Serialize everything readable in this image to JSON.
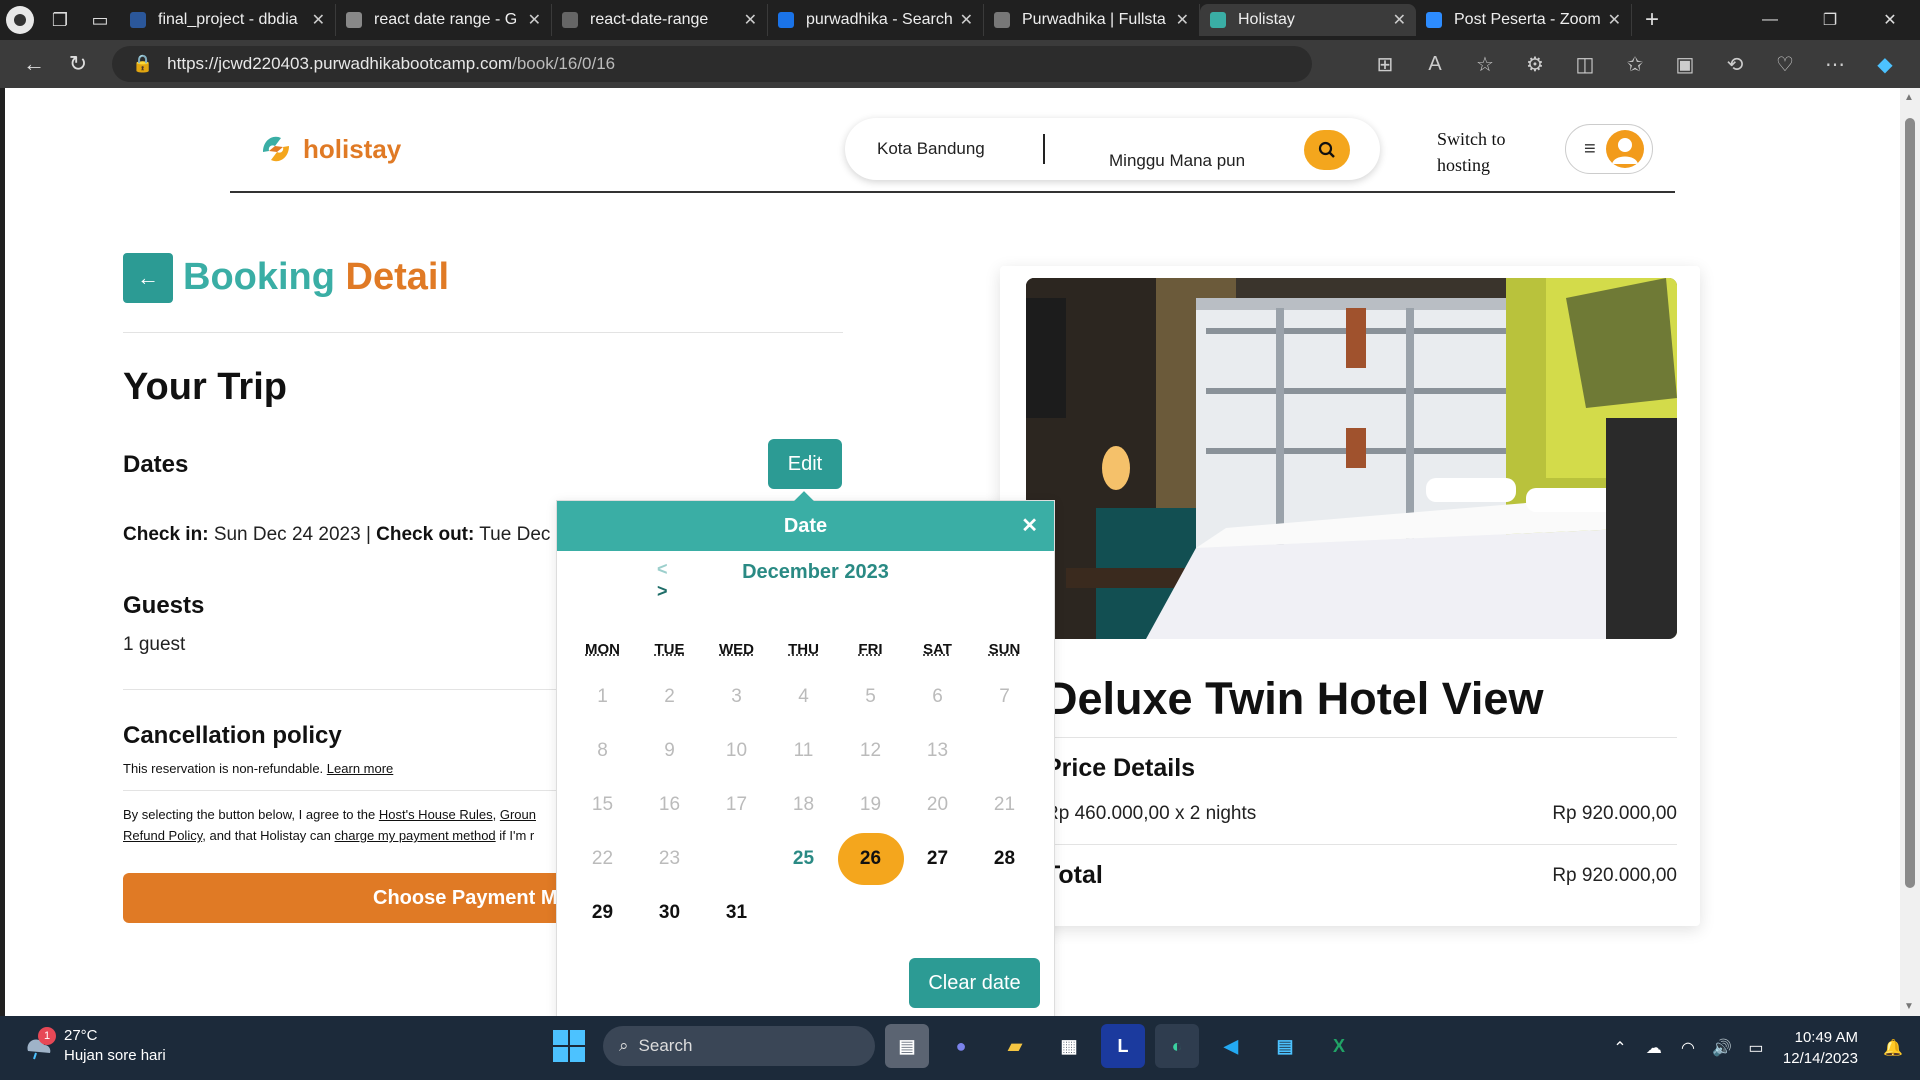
{
  "browser": {
    "tabs": [
      {
        "title": "final_project - dbdia",
        "color": "#2b579a"
      },
      {
        "title": "react date range - G",
        "color": "#888888"
      },
      {
        "title": "react-date-range",
        "color": "#666666"
      },
      {
        "title": "purwadhika - Search",
        "color": "#1a73e8"
      },
      {
        "title": "Purwadhika | Fullsta",
        "color": "#777777"
      },
      {
        "title": "Holistay",
        "color": "#3aaea5",
        "active": true
      },
      {
        "title": "Post Peserta - Zoom",
        "color": "#2d8cff"
      }
    ],
    "url_host": "https://jcwd220403.purwadhikabootcamp.com",
    "url_path": "/book/16/0/16"
  },
  "header": {
    "logo_text": "holistay",
    "search_location": "Kota Bandung",
    "search_week": "Minggu Mana pun",
    "switch_hosting": "Switch to hosting"
  },
  "booking": {
    "title_a": "Booking",
    "title_b": "Detail",
    "your_trip": "Your Trip",
    "dates_heading": "Dates",
    "edit_label": "Edit",
    "check_in_label": "Check in:",
    "check_in_value": "Sun Dec 24 2023",
    "separator": "|",
    "check_out_label": "Check out:",
    "check_out_value": "Tue Dec",
    "guests_heading": "Guests",
    "guests_value": "1 guest",
    "cancel_heading": "Cancellation policy",
    "cancel_text": "This reservation is non-refundable.",
    "learn_more": "Learn more",
    "agree_prefix": "By selecting the button below, I agree to the",
    "agree_link1": "Host's House Rules",
    "agree_link2": "Groun",
    "agree_link3": "Refund Policy",
    "agree_middle": ", and that Holistay can",
    "agree_link4": "charge my payment method",
    "agree_suffix": "if I'm r",
    "pay_button": "Choose Payment Me"
  },
  "summary": {
    "room_title": "Deluxe Twin Hotel View",
    "price_heading": "Price Details",
    "price_line": "Rp 460.000,00 x 2 nights",
    "price_amount": "Rp 920.000,00",
    "total_label": "Total",
    "total_amount": "Rp 920.000,00"
  },
  "datepicker": {
    "title": "Date",
    "close": "✕",
    "prev": "<",
    "next": ">",
    "month": "December 2023",
    "weekdays": [
      "MON",
      "TUE",
      "WED",
      "THU",
      "FRI",
      "SAT",
      "SUN"
    ],
    "weeks": [
      [
        {
          "d": "1",
          "s": "past"
        },
        {
          "d": "2",
          "s": "past"
        },
        {
          "d": "3",
          "s": "past"
        },
        {
          "d": "4",
          "s": "past"
        },
        {
          "d": "5",
          "s": "past"
        },
        {
          "d": "6",
          "s": "past"
        },
        {
          "d": "7",
          "s": "past"
        }
      ],
      [
        {
          "d": "8",
          "s": "past"
        },
        {
          "d": "9",
          "s": "past"
        },
        {
          "d": "10",
          "s": "past"
        },
        {
          "d": "11",
          "s": "past"
        },
        {
          "d": "12",
          "s": "past"
        },
        {
          "d": "13",
          "s": "past"
        },
        {
          "d": "",
          "s": "empty"
        }
      ],
      [
        {
          "d": "15",
          "s": "past"
        },
        {
          "d": "16",
          "s": "past"
        },
        {
          "d": "17",
          "s": "past"
        },
        {
          "d": "18",
          "s": "past"
        },
        {
          "d": "19",
          "s": "past"
        },
        {
          "d": "20",
          "s": "past"
        },
        {
          "d": "21",
          "s": "past"
        }
      ],
      [
        {
          "d": "22",
          "s": "past"
        },
        {
          "d": "23",
          "s": "past"
        },
        {
          "d": "",
          "s": "empty"
        },
        {
          "d": "25",
          "s": "today"
        },
        {
          "d": "26",
          "s": "sel"
        },
        {
          "d": "27",
          "s": "on"
        },
        {
          "d": "28",
          "s": "on"
        }
      ],
      [
        {
          "d": "29",
          "s": "on"
        },
        {
          "d": "30",
          "s": "on"
        },
        {
          "d": "31",
          "s": "on"
        }
      ]
    ],
    "clear_label": "Clear date"
  },
  "taskbar": {
    "weather_badge": "1",
    "temperature": "27°C",
    "weather_desc": "Hujan sore hari",
    "search_label": "Search",
    "time": "10:49 AM",
    "date": "12/14/2023"
  },
  "colors": {
    "teal": "#3aaea5",
    "orange": "#e07a25",
    "amber": "#f4a61d"
  }
}
